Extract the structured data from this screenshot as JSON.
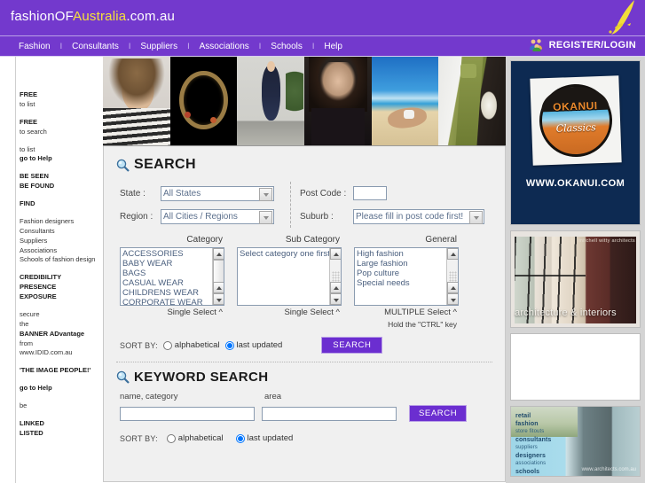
{
  "header": {
    "logo_part1": "fashionOF",
    "logo_highlight": "Australia",
    "logo_part3": ".com.au",
    "quill_icon": "quill-pen-icon",
    "brand_purple": "#7339cd",
    "accent_yellow": "#f5e03c"
  },
  "nav": {
    "items": [
      {
        "label": "Fashion"
      },
      {
        "label": "Consultants"
      },
      {
        "label": "Suppliers"
      },
      {
        "label": "Associations"
      },
      {
        "label": "Schools"
      },
      {
        "label": "Help"
      }
    ],
    "separator": "I",
    "register_label": "REGISTER/LOGIN",
    "register_icon": "people-group-icon"
  },
  "banner": {
    "photos": [
      {
        "alt": "striped-top-model-photo"
      },
      {
        "alt": "necklace-jewellery-photo"
      },
      {
        "alt": "polka-dot-dress-photo"
      },
      {
        "alt": "dark-haired-model-photo"
      },
      {
        "alt": "beach-swimwear-photo"
      },
      {
        "alt": "green-tie-boutonniere-photo"
      }
    ]
  },
  "sidebar_left": {
    "blocks": [
      {
        "lines": [
          {
            "text": "FREE",
            "bold": true
          },
          {
            "text": "to list",
            "bold": false
          }
        ]
      },
      {
        "lines": [
          {
            "text": "FREE",
            "bold": true
          },
          {
            "text": "to search",
            "bold": false
          }
        ]
      },
      {
        "lines": [
          {
            "text": "to list",
            "bold": false
          },
          {
            "text": "go to Help",
            "bold": true
          }
        ]
      },
      {
        "lines": [
          {
            "text": "BE SEEN",
            "bold": true
          },
          {
            "text": "BE FOUND",
            "bold": true
          }
        ]
      },
      {
        "lines": [
          {
            "text": "FIND",
            "bold": true
          }
        ]
      },
      {
        "lines": [
          {
            "text": "Fashion designers",
            "bold": false
          },
          {
            "text": "Consultants",
            "bold": false
          },
          {
            "text": "Suppliers",
            "bold": false
          },
          {
            "text": "Associations",
            "bold": false
          },
          {
            "text": "Schools of fashion design",
            "bold": false
          }
        ]
      },
      {
        "lines": [
          {
            "text": "CREDIBILITY",
            "bold": true
          },
          {
            "text": "PRESENCE",
            "bold": true
          },
          {
            "text": "EXPOSURE",
            "bold": true
          }
        ]
      },
      {
        "lines": [
          {
            "text": "secure",
            "bold": false
          },
          {
            "text": "the",
            "bold": false
          },
          {
            "text": "BANNER ADvantage",
            "bold": true
          },
          {
            "text": "from",
            "bold": false
          },
          {
            "text": "www.IDID.com.au",
            "bold": false
          }
        ]
      },
      {
        "lines": [
          {
            "text": "'THE IMAGE PEOPLE!'",
            "bold": true
          }
        ]
      },
      {
        "lines": [
          {
            "text": "go to Help",
            "bold": true
          }
        ]
      },
      {
        "lines": [
          {
            "text": "be",
            "bold": false
          }
        ]
      },
      {
        "lines": [
          {
            "text": "LINKED",
            "bold": true
          },
          {
            "text": "LISTED",
            "bold": true
          }
        ]
      }
    ]
  },
  "search": {
    "heading": "SEARCH",
    "heading_icon": "magnifier-icon",
    "state_label": "State :",
    "state_value": "All States",
    "state_options": [
      "All States"
    ],
    "region_label": "Region :",
    "region_value": "All Cities / Regions",
    "region_options": [
      "All Cities / Regions"
    ],
    "postcode_label": "Post Code :",
    "postcode_value": "",
    "suburb_label": "Suburb :",
    "suburb_value": "Please fill in post code first!",
    "suburb_options": [
      "Please fill in post code first!"
    ],
    "category": {
      "heading": "Category",
      "items": [
        "ACCESSORIES",
        "BABY WEAR",
        "BAGS",
        "CASUAL WEAR",
        "CHILDRENS WEAR",
        "CORPORATE WEAR"
      ],
      "footer": "Single Select ^"
    },
    "subcategory": {
      "heading": "Sub Category",
      "items": [
        "Select category one first"
      ],
      "footer": "Single Select ^"
    },
    "general": {
      "heading": "General",
      "items": [
        "High fashion",
        "Large fashion",
        "Pop culture",
        "Special needs"
      ],
      "footer": "MULTIPLE Select ^",
      "hint": "Hold the \"CTRL\" key"
    },
    "sort_label": "SORT BY:",
    "sort_options": [
      {
        "label": "alphabetical",
        "selected": false
      },
      {
        "label": "last updated",
        "selected": true
      }
    ],
    "button_label": "SEARCH",
    "button_color": "#6b2ed0"
  },
  "keyword_search": {
    "heading": "KEYWORD SEARCH",
    "heading_icon": "magnifier-icon",
    "name_label": "name, category",
    "area_label": "area",
    "name_value": "",
    "area_value": "",
    "button_label": "SEARCH",
    "sort_label": "SORT BY:",
    "sort_options": [
      {
        "label": "alphabetical",
        "selected": false
      },
      {
        "label": "last updated",
        "selected": true
      }
    ]
  },
  "ads": {
    "okanui": {
      "brand": "OKANUI",
      "script": "Classics",
      "url": "WWW.OKANUI.COM",
      "bg_color": "#0d2a52"
    },
    "architecture": {
      "top_caption": "mitchell witty architects",
      "caption": "architecture & interiors"
    },
    "blank": {
      "alt": "empty-ad-slot"
    },
    "bottom": {
      "lines": [
        {
          "text": "retail",
          "small": false
        },
        {
          "text": "fashion",
          "small": false
        },
        {
          "text": "store fitouts",
          "small": true
        },
        {
          "text": "consultants",
          "small": false
        },
        {
          "text": "suppliers",
          "small": true
        },
        {
          "text": "designers",
          "small": false
        },
        {
          "text": "associations",
          "small": true
        },
        {
          "text": "schools",
          "small": false
        }
      ],
      "watermark": "www.architects.com.au"
    }
  }
}
